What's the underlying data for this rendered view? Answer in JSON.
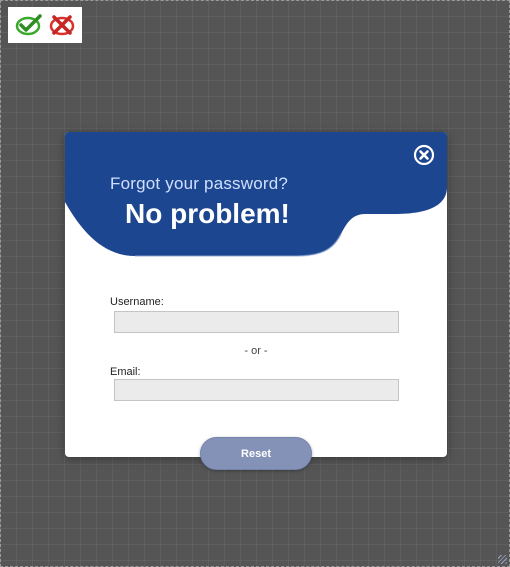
{
  "toolbar": {
    "accept_icon": "green-checkmark-icon",
    "reject_icon": "red-x-icon",
    "colors": {
      "accept": "#3aa82a",
      "reject": "#d9302c"
    }
  },
  "dialog": {
    "heading": "Forgot your password?",
    "subheading": "No problem!",
    "close_icon": "close-circle-icon",
    "header_color": "#1d4690",
    "username_label": "Username:",
    "username_value": "",
    "or_text": "- or -",
    "email_label": "Email:",
    "email_value": "",
    "reset_label": "Reset",
    "reset_color": "#8592b8"
  }
}
